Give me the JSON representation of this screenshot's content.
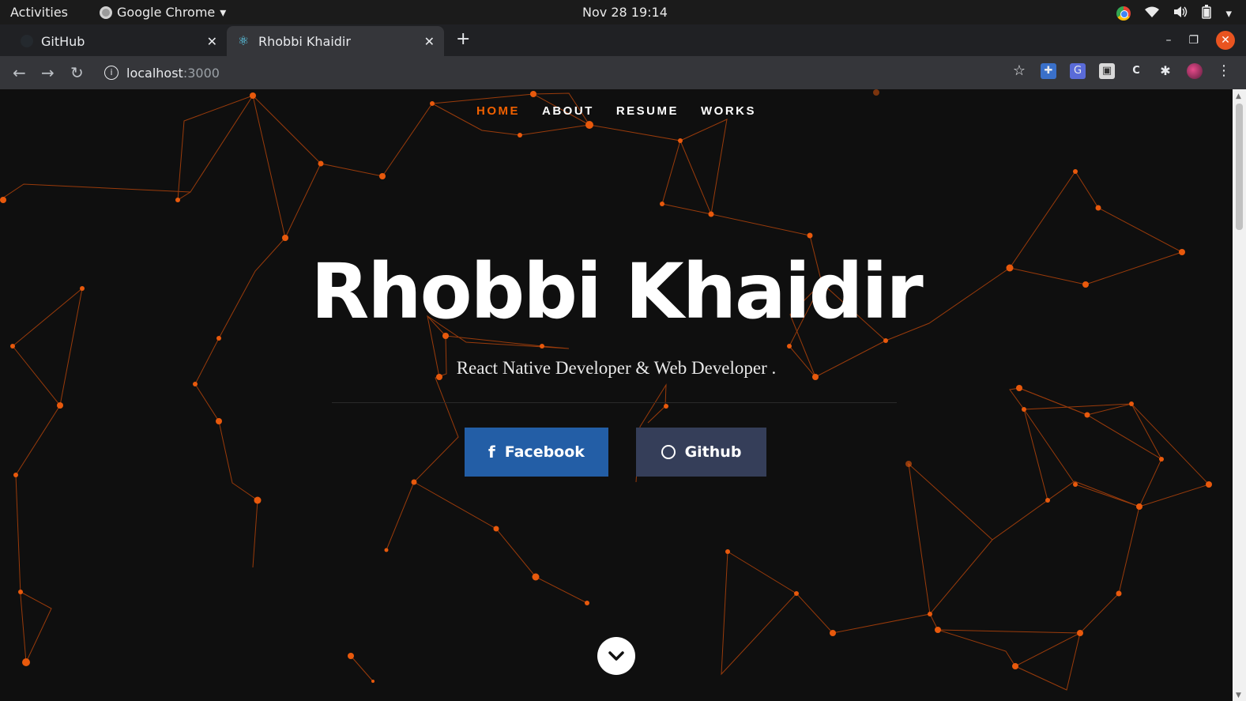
{
  "system_bar": {
    "activities": "Activities",
    "app_name": "Google Chrome",
    "clock": "Nov 28  19:14"
  },
  "browser": {
    "tabs": [
      {
        "label": "GitHub",
        "active": false
      },
      {
        "label": "Rhobbi Khaidir",
        "active": true
      }
    ],
    "url": {
      "host": "localhost",
      "port": ":3000"
    }
  },
  "page": {
    "nav": [
      {
        "label": "HOME",
        "active": true
      },
      {
        "label": "ABOUT",
        "active": false
      },
      {
        "label": "RESUME",
        "active": false
      },
      {
        "label": "WORKS",
        "active": false
      }
    ],
    "title": "Rhobbi Khaidir",
    "subtitle": "React Native Developer & Web Developer .",
    "buttons": {
      "facebook": "Facebook",
      "github": "Github"
    }
  },
  "colors": {
    "accent": "#f06000",
    "background": "#0f0f0f",
    "facebook_button": "#235ea6",
    "github_button": "#353e59"
  }
}
